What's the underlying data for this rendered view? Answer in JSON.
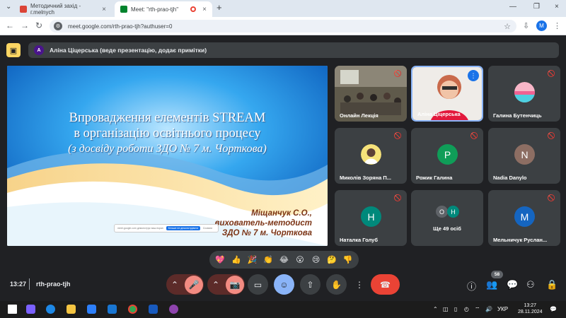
{
  "browser": {
    "tabs": [
      {
        "title": "Методичний захід - г.melnych",
        "active": false
      },
      {
        "title": "Meet: \"rth-prao-tjh\"",
        "active": true
      }
    ],
    "url": "meet.google.com/rth-prao-tjh?authuser=0",
    "profile_initial": "M"
  },
  "meet": {
    "presenter_initial": "A",
    "presenter_label": "Аліна Ціцерська (веде презентацію, додає примітки)",
    "slide": {
      "title_line1": "Впровадження елементів STREAM",
      "title_line2": "в організацію освітнього процесу",
      "title_line3": "(з досвіду роботи ЗДО № 7 м. Чорткова)",
      "author_line1": "Міщанчук С.О.,",
      "author_line2": "вихователь-методист",
      "author_line3": "ЗДО № 7 м. Чорткова",
      "share_text": "meet.google.com демонструє ваш екран",
      "share_stop": "Більше не демонструвати",
      "share_hide": "Сховати"
    },
    "participants": [
      {
        "name": "Онлайн Лекція",
        "type": "photo"
      },
      {
        "name": "Аліна Ціцерська",
        "type": "photo",
        "speaking": true
      },
      {
        "name": "Галина Бутенчиць",
        "type": "image"
      },
      {
        "name": "Миколів Зоряна П...",
        "type": "image"
      },
      {
        "name": "Рожик Галина",
        "initial": "P",
        "color": "#0f9d58"
      },
      {
        "name": "Nadia Danylo",
        "initial": "N",
        "color": "#8d6e63"
      },
      {
        "name": "Наталка Голуб",
        "initial": "Н",
        "color": "#00897b"
      },
      {
        "name": "Ще 49 осіб",
        "initials": [
          "О",
          "Н"
        ]
      },
      {
        "name": "Мельничук Руслан...",
        "initial": "M",
        "color": "#1565c0"
      }
    ],
    "reactions": [
      "💖",
      "👍",
      "🎉",
      "👏",
      "😂",
      "😮",
      "😢",
      "🤔",
      "👎"
    ],
    "time": "13:27",
    "meeting_code": "rth-prao-tjh",
    "participant_count": "58",
    "icons": [
      "mic-off-icon",
      "camera-off-icon",
      "captions-icon",
      "emoji-icon",
      "present-icon",
      "hand-icon",
      "more-icon",
      "end-call-icon"
    ]
  },
  "taskbar": {
    "language": "УКР",
    "time": "13:27",
    "date": "28.11.2024"
  }
}
